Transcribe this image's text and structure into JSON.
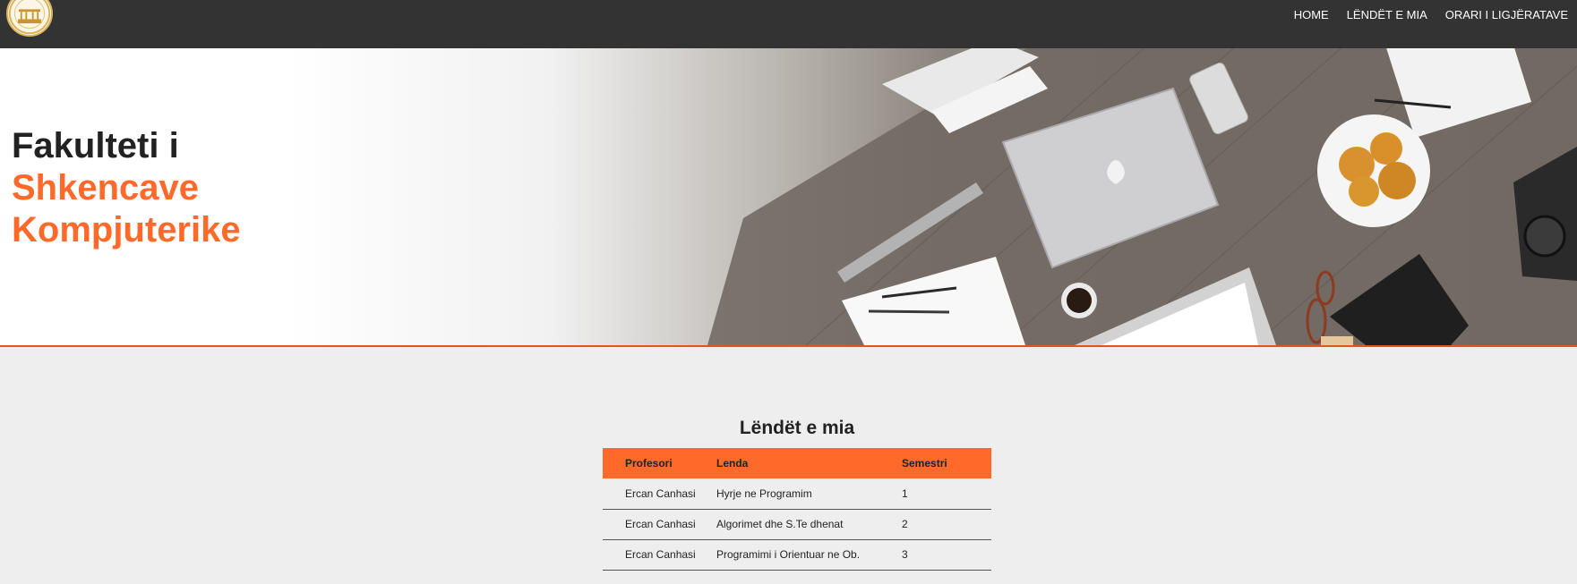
{
  "nav": {
    "logo_alt": "university-seal",
    "links": [
      "HOME",
      "LËNDËT E MIA",
      "ORARI I LIGJËRATAVE"
    ]
  },
  "hero": {
    "title_line1": "Fakulteti i",
    "title_line2": "Shkencave",
    "title_line3": "Kompjuterike"
  },
  "courses": {
    "title": "Lëndët e mia",
    "headers": [
      "Profesori",
      "Lenda",
      "Semestri"
    ],
    "rows": [
      [
        "Ercan Canhasi",
        "Hyrje ne Programim",
        "1"
      ],
      [
        "Ercan Canhasi",
        "Algorimet dhe S.Te dhenat",
        "2"
      ],
      [
        "Ercan Canhasi",
        "Programimi i Orientuar ne Ob.",
        "3"
      ]
    ]
  },
  "colors": {
    "navbar": "#333333",
    "accent": "#ff6a2b",
    "page_bg": "#eeeeee"
  }
}
